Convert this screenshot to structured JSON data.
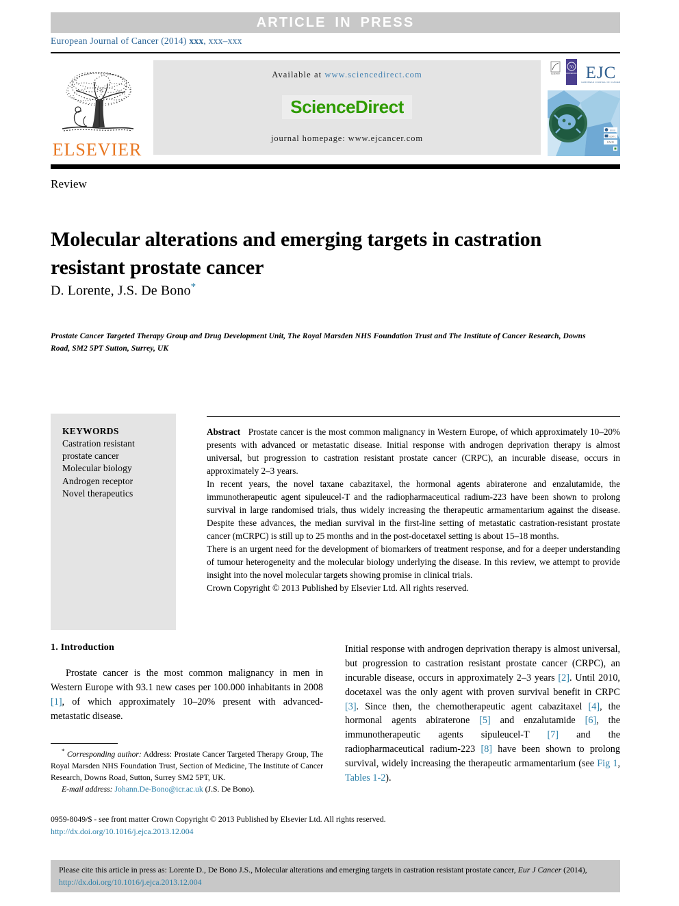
{
  "banner": {
    "article_in_press": "ARTICLE  IN  PRESS"
  },
  "journal_ref": {
    "prefix": "European Journal of Cancer (2014) ",
    "volume": "xxx",
    "suffix": ", xxx–xxx"
  },
  "masthead": {
    "publisher_logo_text": "ELSEVIER",
    "publisher_logo_icon": "elsevier-tree-icon",
    "available_label": "Available at ",
    "available_url": "www.sciencedirect.com",
    "sciencedirect_logo": "ScienceDirect",
    "homepage_line": "journal homepage: www.ejcancer.com",
    "cover_title": "EJC",
    "cover_subtitle": "EUROPEAN JOURNAL OF CANCER",
    "cover_anniversary": "50",
    "cover_icon": "ejc-journal-cover-icon"
  },
  "document": {
    "type_label": "Review",
    "title": "Molecular alterations and emerging targets in castration resistant prostate cancer",
    "authors": "D. Lorente, J.S. De Bono",
    "corresponding_marker": "*",
    "affiliation": "Prostate Cancer Targeted Therapy Group and Drug Development Unit, The Royal Marsden NHS Foundation Trust and The Institute of Cancer Research, Downs Road, SM2 5PT Sutton, Surrey, UK"
  },
  "keywords": {
    "heading": "KEYWORDS",
    "items": [
      "Castration resistant",
      "prostate cancer",
      "Molecular biology",
      "Androgen receptor",
      "Novel therapeutics"
    ]
  },
  "abstract": {
    "label": "Abstract",
    "paragraph1": "Prostate cancer is the most common malignancy in Western Europe, of which approximately 10–20% presents with advanced or metastatic disease. Initial response with androgen deprivation therapy is almost universal, but progression to castration resistant prostate cancer (CRPC), an incurable disease, occurs in approximately 2–3 years.",
    "paragraph2": "In recent years, the novel taxane cabazitaxel, the hormonal agents abiraterone and enzalutamide, the immunotherapeutic agent sipuleucel-T and the radiopharmaceutical radium-223 have been shown to prolong survival in large randomised trials, thus widely increasing the therapeutic armamentarium against the disease. Despite these advances, the median survival in the first-line setting of metastatic castration-resistant prostate cancer (mCRPC) is still up to 25 months and in the post-docetaxel setting is about 15–18 months.",
    "paragraph3": "There is an urgent need for the development of biomarkers of treatment response, and for a deeper understanding of tumour heterogeneity and the molecular biology underlying the disease. In this review, we attempt to provide insight into the novel molecular targets showing promise in clinical trials.",
    "copyright_line": "Crown Copyright © 2013 Published by Elsevier Ltd. All rights reserved."
  },
  "introduction": {
    "heading": "1. Introduction",
    "left_paragraph_pre": "Prostate cancer is the most common malignancy in men in Western Europe with 93.1 new cases per 100.000 inhabitants in 2008 ",
    "left_ref1": "[1]",
    "left_paragraph_post": ", of which approximately 10–20% present with advanced-metastatic disease.",
    "right_part1": "Initial response with androgen deprivation therapy is almost universal, but progression to castration resistant prostate cancer (CRPC), an incurable disease, occurs in approximately 2–3 years ",
    "right_ref2": "[2]",
    "right_part2": ". Until 2010, docetaxel was the only agent with proven survival benefit in CRPC ",
    "right_ref3": "[3]",
    "right_part3": ". Since then, the chemotherapeutic agent cabazitaxel ",
    "right_ref4": "[4]",
    "right_part4": ", the hormonal agents abiraterone ",
    "right_ref5": "[5]",
    "right_part5": " and enzalutamide ",
    "right_ref6": "[6]",
    "right_part6": ", the immunotherapeutic agents sipuleucel-T ",
    "right_ref7": "[7]",
    "right_part7": " and the radiopharmaceutical radium-223 ",
    "right_ref8": "[8]",
    "right_part8": " have been shown to prolong survival, widely increasing the therapeutic armamentarium (see ",
    "right_link_fig": "Fig 1",
    "right_part9": ", ",
    "right_link_tables": "Tables 1-2",
    "right_part10": ")."
  },
  "footnote": {
    "star": "*",
    "corresponding_label": "Corresponding author:",
    "address": " Address: Prostate Cancer Targeted Therapy Group, The Royal Marsden NHS Foundation Trust, Section of Medicine, The Institute of Cancer Research, Downs Road, Sutton, Surrey SM2 5PT, UK.",
    "email_label": "E-mail address:",
    "email": "Johann.De-Bono@icr.ac.uk",
    "email_suffix": " (J.S. De Bono)."
  },
  "footer": {
    "issn_line": "0959-8049/$ - see front matter Crown Copyright © 2013 Published by Elsevier Ltd. All rights reserved.",
    "doi": "http://dx.doi.org/10.1016/j.ejca.2013.12.004"
  },
  "citation": {
    "lead": "Please cite this article in press as: Lorente D., De Bono J.S., Molecular alterations and emerging targets in castration resistant prostate cancer, ",
    "journal_italic": "Eur J Cancer",
    "year": " (2014), ",
    "doi": "http://dx.doi.org/10.1016/j.ejca.2013.12.004"
  },
  "colors": {
    "banner_gray": "#c8c8c8",
    "panel_gray": "#e4e4e4",
    "link_blue": "#2a7fa8",
    "journal_blue": "#2a6496",
    "elsevier_orange": "#E87722",
    "sciencedirect_green": "#2E9B00"
  }
}
